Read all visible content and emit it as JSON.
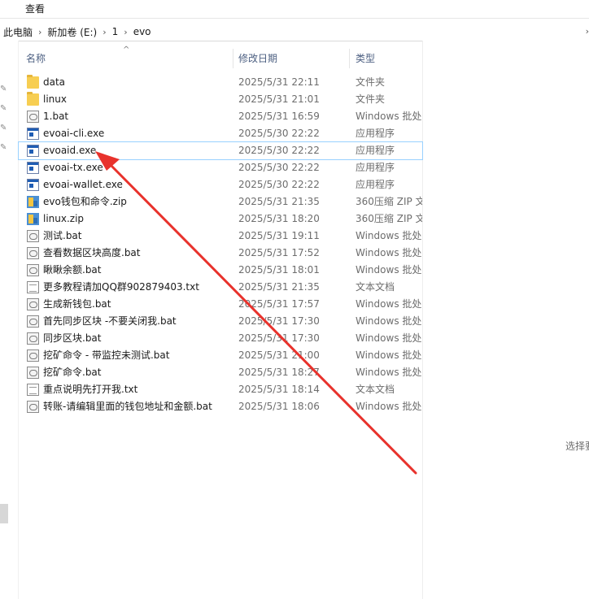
{
  "ribbon": {
    "view_menu": "查看"
  },
  "address": {
    "crumbs": [
      "此电脑",
      "新加卷 (E:)",
      "1",
      "evo"
    ],
    "separator": "›",
    "chevron": "›"
  },
  "columns": {
    "name": "名称",
    "date": "修改日期",
    "type": "类型",
    "sort_indicator": "^"
  },
  "files": [
    {
      "name": "data",
      "date": "2025/5/31 22:11",
      "type": "文件夹",
      "icon": "folder-icon"
    },
    {
      "name": "linux",
      "date": "2025/5/31 21:01",
      "type": "文件夹",
      "icon": "folder-icon"
    },
    {
      "name": "1.bat",
      "date": "2025/5/31 16:59",
      "type": "Windows 批处",
      "icon": "bat-icon"
    },
    {
      "name": "evoai-cli.exe",
      "date": "2025/5/30 22:22",
      "type": "应用程序",
      "icon": "exe-icon"
    },
    {
      "name": "evoaid.exe",
      "date": "2025/5/30 22:22",
      "type": "应用程序",
      "icon": "exe-icon",
      "selected": true
    },
    {
      "name": "evoai-tx.exe",
      "date": "2025/5/30 22:22",
      "type": "应用程序",
      "icon": "exe-icon"
    },
    {
      "name": "evoai-wallet.exe",
      "date": "2025/5/30 22:22",
      "type": "应用程序",
      "icon": "exe-icon"
    },
    {
      "name": "evo钱包和命令.zip",
      "date": "2025/5/31 21:35",
      "type": "360压缩 ZIP 文",
      "icon": "zip-icon"
    },
    {
      "name": "linux.zip",
      "date": "2025/5/31 18:20",
      "type": "360压缩 ZIP 文",
      "icon": "zip-icon"
    },
    {
      "name": "测试.bat",
      "date": "2025/5/31 19:11",
      "type": "Windows 批处",
      "icon": "bat-icon"
    },
    {
      "name": "查看数据区块高度.bat",
      "date": "2025/5/31 17:52",
      "type": "Windows 批处",
      "icon": "bat-icon"
    },
    {
      "name": "瞅瞅余额.bat",
      "date": "2025/5/31 18:01",
      "type": "Windows 批处",
      "icon": "bat-icon"
    },
    {
      "name": "更多教程请加QQ群902879403.txt",
      "date": "2025/5/31 21:35",
      "type": "文本文档",
      "icon": "txt-icon"
    },
    {
      "name": "生成新钱包.bat",
      "date": "2025/5/31 17:57",
      "type": "Windows 批处",
      "icon": "bat-icon"
    },
    {
      "name": "首先同步区块 -不要关闭我.bat",
      "date": "2025/5/31 17:30",
      "type": "Windows 批处",
      "icon": "bat-icon"
    },
    {
      "name": "同步区块.bat",
      "date": "2025/5/31 17:30",
      "type": "Windows 批处",
      "icon": "bat-icon"
    },
    {
      "name": "挖矿命令 - 带监控未测试.bat",
      "date": "2025/5/31 21:00",
      "type": "Windows 批处",
      "icon": "bat-icon"
    },
    {
      "name": "挖矿命令.bat",
      "date": "2025/5/31 18:27",
      "type": "Windows 批处",
      "icon": "bat-icon"
    },
    {
      "name": "重点说明先打开我.txt",
      "date": "2025/5/31 18:14",
      "type": "文本文档",
      "icon": "txt-icon"
    },
    {
      "name": "转账-请编辑里面的钱包地址和金额.bat",
      "date": "2025/5/31 18:06",
      "type": "Windows 批处",
      "icon": "bat-icon"
    }
  ],
  "preview": {
    "message": "选择要"
  },
  "colors": {
    "arrow": "#e8322c",
    "selection": "#99d1ff",
    "header_text": "#4d6082"
  }
}
